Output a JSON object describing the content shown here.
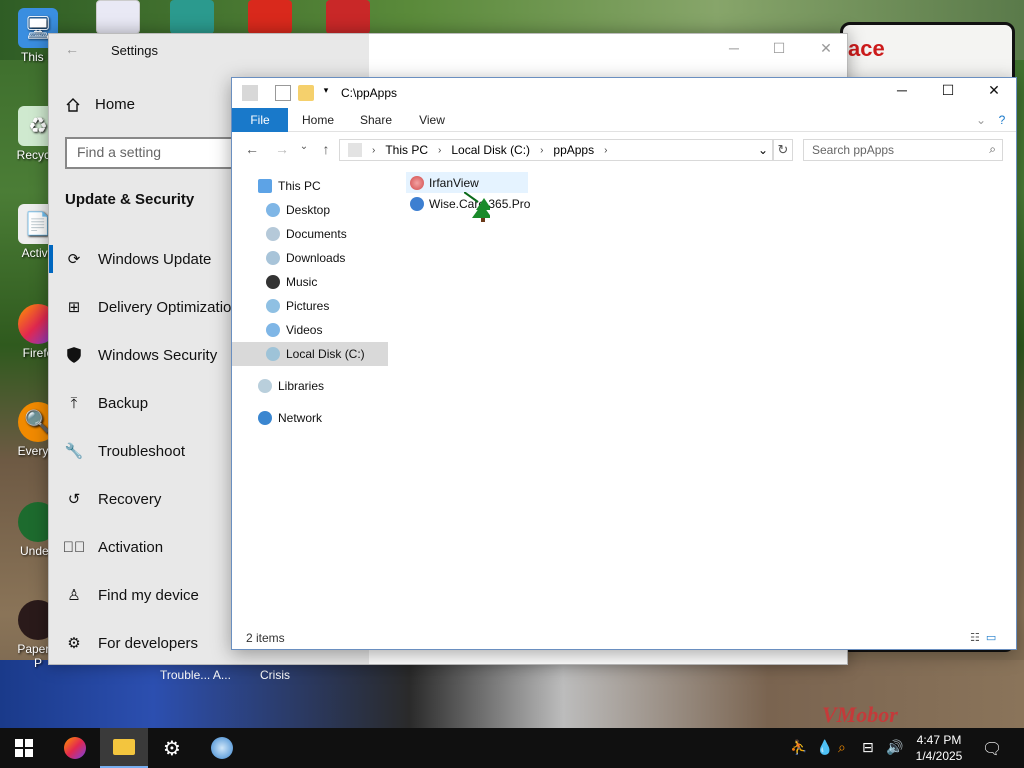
{
  "desktop": {
    "icons": [
      {
        "label": "This P",
        "icon": "computer-icon"
      },
      {
        "label": "Recycle",
        "icon": "recycle-bin-icon"
      },
      {
        "label": "Activa",
        "icon": "document-icon"
      },
      {
        "label": "Firefo",
        "icon": "firefox-icon"
      },
      {
        "label": "Everyth",
        "icon": "everything-search-icon"
      },
      {
        "label": "Undert",
        "icon": "undertale-icon"
      },
      {
        "label": "Papers, P",
        "icon": "papers-please-icon"
      }
    ],
    "background_labels": [
      "Trouble... A...",
      "Crisis"
    ],
    "sign_text": "ace",
    "watermark": "VMobor"
  },
  "settings": {
    "title": "Settings",
    "home_label": "Home",
    "search_placeholder": "Find a setting",
    "section_title": "Update & Security",
    "nav_items": [
      {
        "label": "Windows Update",
        "icon": "refresh-icon",
        "active": true
      },
      {
        "label": "Delivery Optimization",
        "icon": "delivery-optimization-icon",
        "active": false
      },
      {
        "label": "Windows Security",
        "icon": "shield-icon",
        "active": false
      },
      {
        "label": "Backup",
        "icon": "backup-arrow-icon",
        "active": false
      },
      {
        "label": "Troubleshoot",
        "icon": "wrench-icon",
        "active": false
      },
      {
        "label": "Recovery",
        "icon": "recovery-icon",
        "active": false
      },
      {
        "label": "Activation",
        "icon": "check-circle-icon",
        "active": false
      },
      {
        "label": "Find my device",
        "icon": "person-location-icon",
        "active": false
      },
      {
        "label": "For developers",
        "icon": "developer-tools-icon",
        "active": false
      }
    ]
  },
  "explorer": {
    "title": "C:\\ppApps",
    "ribbon_tabs": [
      "File",
      "Home",
      "Share",
      "View"
    ],
    "breadcrumb": [
      "This PC",
      "Local Disk (C:)",
      "ppApps"
    ],
    "search_placeholder": "Search ppApps",
    "tree": [
      {
        "label": "This PC",
        "icon": "this-pc-icon",
        "level": 0,
        "selected": false
      },
      {
        "label": "Desktop",
        "icon": "desktop-folder-icon",
        "level": 1,
        "selected": false
      },
      {
        "label": "Documents",
        "icon": "documents-folder-icon",
        "level": 1,
        "selected": false
      },
      {
        "label": "Downloads",
        "icon": "downloads-folder-icon",
        "level": 1,
        "selected": false
      },
      {
        "label": "Music",
        "icon": "music-folder-icon",
        "level": 1,
        "selected": false
      },
      {
        "label": "Pictures",
        "icon": "pictures-folder-icon",
        "level": 1,
        "selected": false
      },
      {
        "label": "Videos",
        "icon": "videos-folder-icon",
        "level": 1,
        "selected": false
      },
      {
        "label": "Local Disk (C:)",
        "icon": "local-disk-icon",
        "level": 1,
        "selected": true
      },
      {
        "label": "Libraries",
        "icon": "libraries-icon",
        "level": 0,
        "selected": false
      },
      {
        "label": "Network",
        "icon": "network-icon",
        "level": 0,
        "selected": false
      }
    ],
    "files": [
      {
        "name": "IrfanView",
        "icon": "irfanview-icon"
      },
      {
        "name": "Wise.Care.365.Pro",
        "icon": "wise-care-icon"
      }
    ],
    "status": "2 items"
  },
  "taskbar": {
    "apps": [
      {
        "name": "start",
        "icon": "windows-logo-icon"
      },
      {
        "name": "firefox",
        "icon": "firefox-icon"
      },
      {
        "name": "file-explorer",
        "icon": "folder-icon"
      },
      {
        "name": "settings",
        "icon": "gear-icon"
      },
      {
        "name": "app",
        "icon": "globe-icon"
      }
    ],
    "time": "4:47 PM",
    "date": "1/4/2025"
  },
  "colors": {
    "accent": "#0067c0",
    "ribbon_file": "#1979ca",
    "taskbar": "#101010"
  }
}
